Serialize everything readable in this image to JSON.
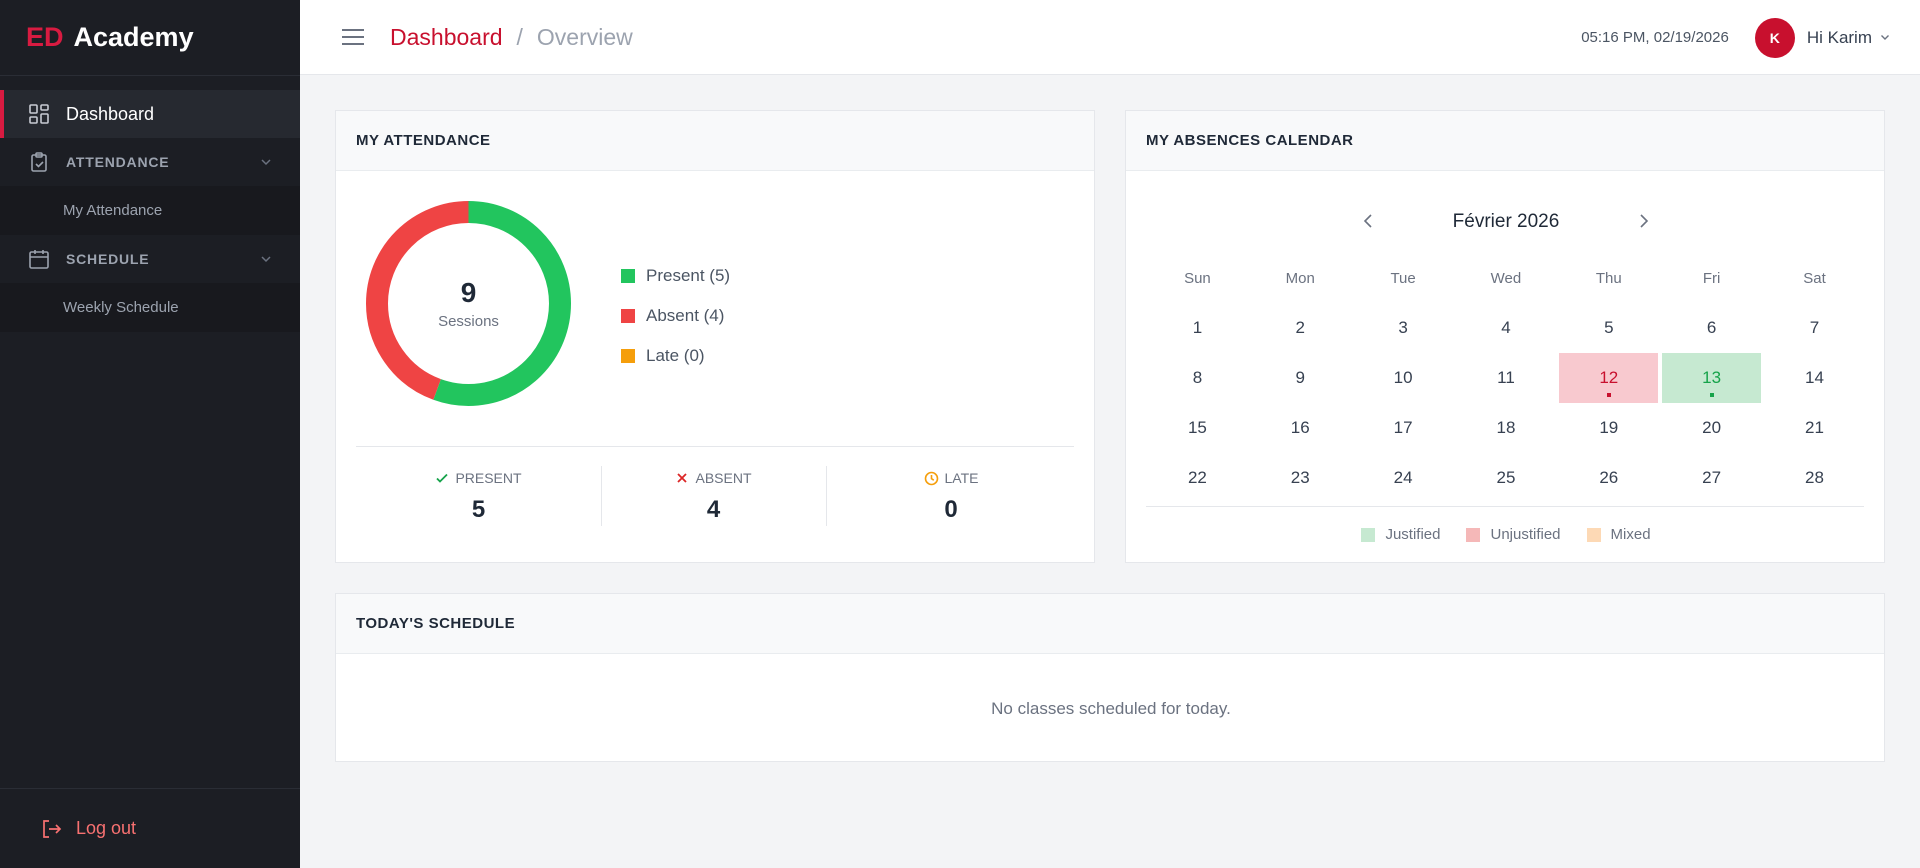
{
  "brand": {
    "prefix": "ED",
    "name": "Academy"
  },
  "sidebar": {
    "dashboard": "Dashboard",
    "groups": [
      {
        "label": "ATTENDANCE",
        "items": [
          "My Attendance"
        ]
      },
      {
        "label": "SCHEDULE",
        "items": [
          "Weekly Schedule"
        ]
      }
    ],
    "logout": "Log out"
  },
  "header": {
    "breadcrumb": [
      "Dashboard",
      "Overview"
    ],
    "separator": "/",
    "datetime": "05:16 PM, 02/19/2026",
    "avatar_initial": "K",
    "greeting": "Hi Karim"
  },
  "attendance": {
    "title": "MY ATTENDANCE",
    "total": "9",
    "total_label": "Sessions",
    "legend": [
      {
        "label": "Present (5)",
        "color": "#22c55e"
      },
      {
        "label": "Absent (4)",
        "color": "#ef4444"
      },
      {
        "label": "Late (0)",
        "color": "#f59e0b"
      }
    ],
    "stats": [
      {
        "label": "PRESENT",
        "value": "5",
        "color": "#16a34a",
        "icon": "check-icon"
      },
      {
        "label": "ABSENT",
        "value": "4",
        "color": "#dc2626",
        "icon": "x-icon"
      },
      {
        "label": "LATE",
        "value": "0",
        "color": "#f59e0b",
        "icon": "clock-icon"
      }
    ],
    "chart_data": {
      "type": "pie",
      "categories": [
        "Present",
        "Absent",
        "Late"
      ],
      "values": [
        5,
        4,
        0
      ],
      "colors": [
        "#22c55e",
        "#ef4444",
        "#f59e0b"
      ]
    }
  },
  "calendar": {
    "title": "MY ABSENCES CALENDAR",
    "month": "Février 2026",
    "weekdays": [
      "Sun",
      "Mon",
      "Tue",
      "Wed",
      "Thu",
      "Fri",
      "Sat"
    ],
    "weeks": [
      [
        "1",
        "2",
        "3",
        "4",
        "5",
        "6",
        "7"
      ],
      [
        "8",
        "9",
        "10",
        "11",
        "12",
        "13",
        "14"
      ],
      [
        "15",
        "16",
        "17",
        "18",
        "19",
        "20",
        "21"
      ],
      [
        "22",
        "23",
        "24",
        "25",
        "26",
        "27",
        "28"
      ]
    ],
    "marked": {
      "12": "unjustified",
      "13": "justified"
    },
    "legend": [
      {
        "label": "Justified",
        "color": "#c6e9d1"
      },
      {
        "label": "Unjustified",
        "color": "#f5b8b8"
      },
      {
        "label": "Mixed",
        "color": "#fdd9b5"
      }
    ]
  },
  "schedule": {
    "title": "TODAY'S SCHEDULE",
    "empty": "No classes scheduled for today."
  }
}
